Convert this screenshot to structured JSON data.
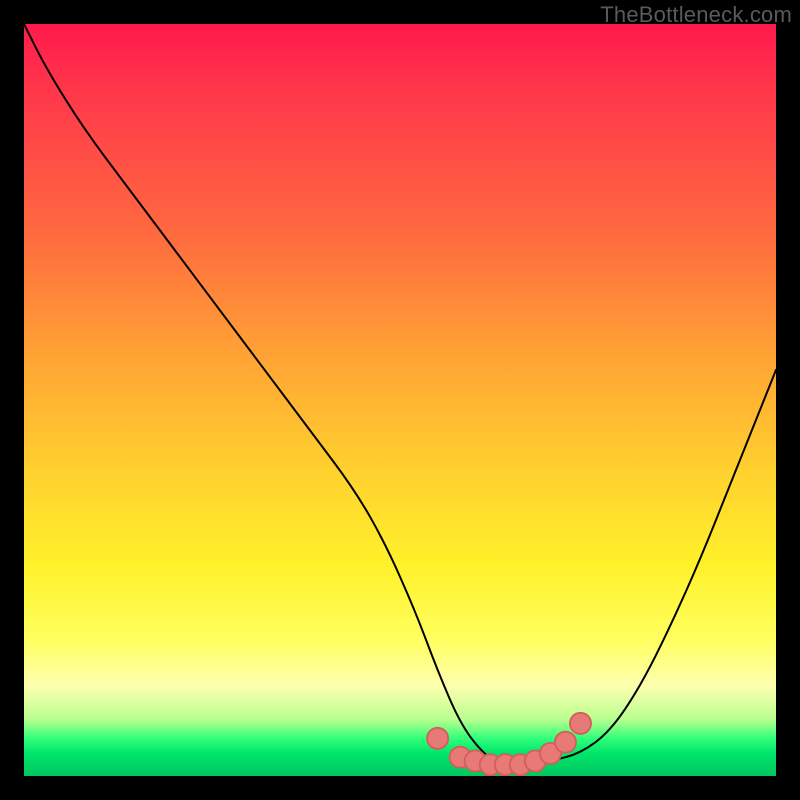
{
  "watermark": {
    "text": "TheBottleneck.com"
  },
  "colors": {
    "frame": "#000000",
    "curve": "#000000",
    "marker_fill": "#e77a77",
    "marker_stroke": "#d45e5b",
    "gradient_stops": [
      "#ff1a4d",
      "#ff3a4a",
      "#ff6a3f",
      "#ffa634",
      "#ffd22e",
      "#fff12a",
      "#ffff60",
      "#fdffb0",
      "#b8ff8e",
      "#2fff7a",
      "#00e56a",
      "#00c75f"
    ]
  },
  "chart_data": {
    "type": "line",
    "title": "",
    "xlabel": "",
    "ylabel": "",
    "xlim": [
      0,
      100
    ],
    "ylim": [
      0,
      100
    ],
    "grid": false,
    "series": [
      {
        "name": "bottleneck-curve",
        "x": [
          0,
          3,
          8,
          14,
          20,
          26,
          32,
          38,
          44,
          48,
          52,
          55,
          58,
          61,
          64,
          67,
          70,
          74,
          78,
          82,
          86,
          90,
          94,
          98,
          100
        ],
        "y": [
          100,
          94,
          86,
          78,
          70,
          62,
          54,
          46,
          38,
          31,
          22,
          14,
          7,
          3,
          1,
          1,
          2,
          3,
          6,
          12,
          20,
          29,
          39,
          49,
          54
        ]
      }
    ],
    "markers": {
      "name": "ideal-zone",
      "x": [
        55,
        58,
        60,
        62,
        64,
        66,
        68,
        70,
        72,
        74
      ],
      "y": [
        5,
        2.5,
        2,
        1.5,
        1.5,
        1.5,
        2,
        3,
        4.5,
        7
      ]
    },
    "background_field": {
      "type": "vertical-gradient",
      "top": "bad",
      "bottom": "good"
    }
  }
}
